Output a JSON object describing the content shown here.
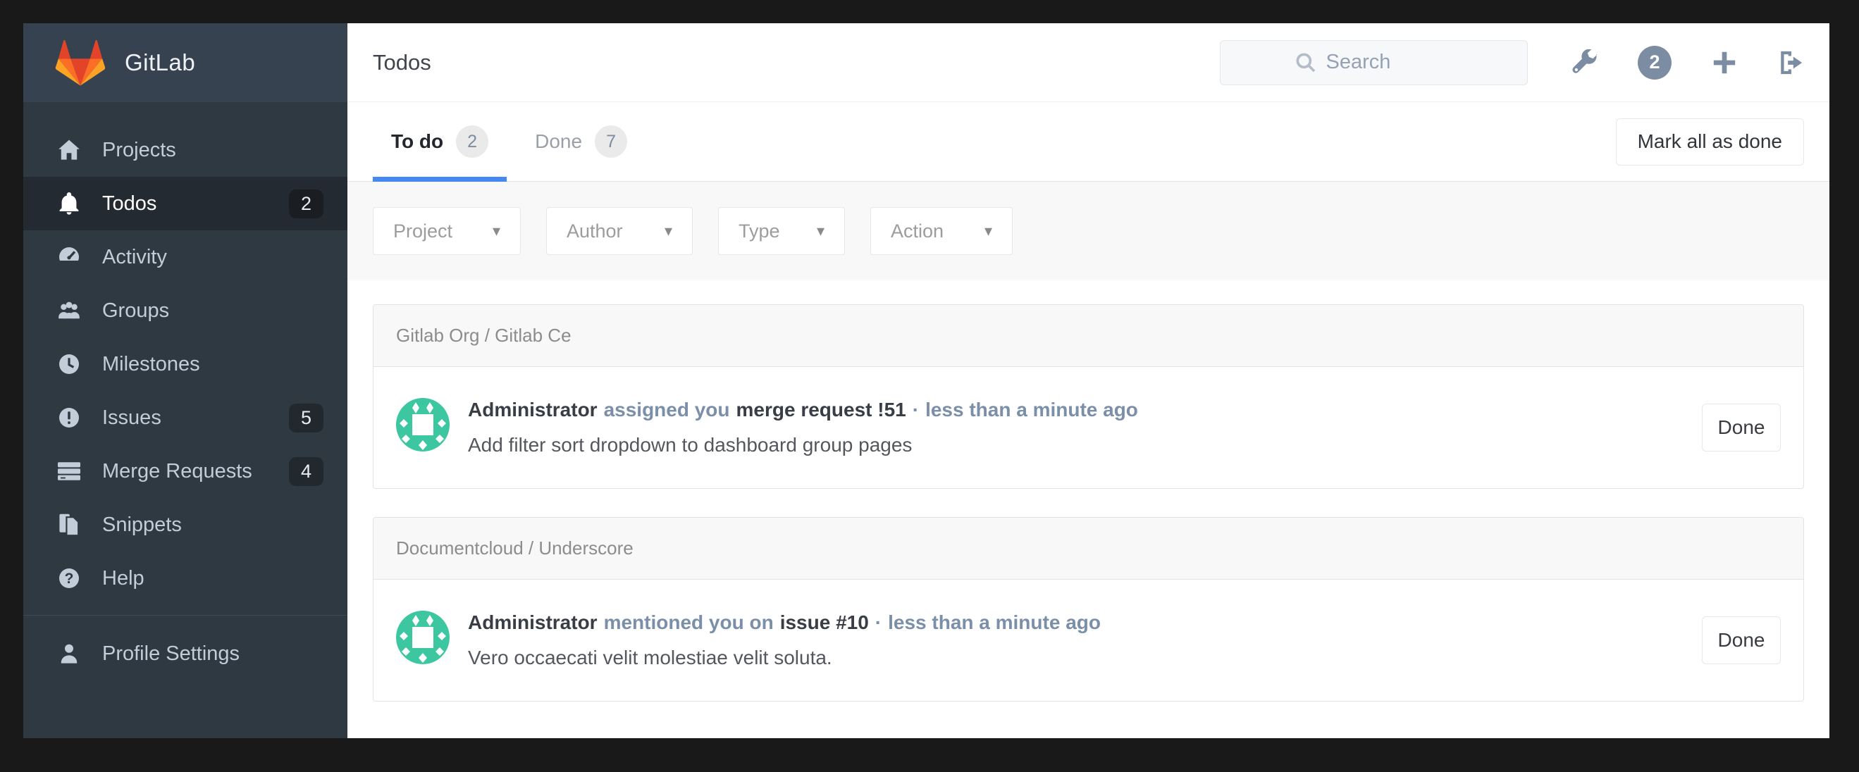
{
  "header": {
    "title": "Todos",
    "search_placeholder": "Search",
    "todo_count_bubble": "2"
  },
  "sidebar": {
    "logo_text": "GitLab",
    "items": [
      {
        "label": "Projects",
        "icon": "home-icon",
        "badge": ""
      },
      {
        "label": "Todos",
        "icon": "bell-icon",
        "badge": "2"
      },
      {
        "label": "Activity",
        "icon": "activity-gauge-icon",
        "badge": ""
      },
      {
        "label": "Groups",
        "icon": "groups-icon",
        "badge": ""
      },
      {
        "label": "Milestones",
        "icon": "clock-icon",
        "badge": ""
      },
      {
        "label": "Issues",
        "icon": "issue-icon",
        "badge": "5"
      },
      {
        "label": "Merge Requests",
        "icon": "merge-requests-icon",
        "badge": "4"
      },
      {
        "label": "Snippets",
        "icon": "snippets-icon",
        "badge": ""
      },
      {
        "label": "Help",
        "icon": "help-icon",
        "badge": ""
      }
    ],
    "footer_item": {
      "label": "Profile Settings",
      "icon": "user-icon"
    }
  },
  "tabs": [
    {
      "label": "To do",
      "count": "2"
    },
    {
      "label": "Done",
      "count": "7"
    }
  ],
  "toolbar": {
    "mark_all_label": "Mark all as done"
  },
  "filters": [
    {
      "label": "Project"
    },
    {
      "label": "Author"
    },
    {
      "label": "Type"
    },
    {
      "label": "Action"
    }
  ],
  "groups": [
    {
      "title": "Gitlab Org / Gitlab Ce",
      "item": {
        "author": "Administrator",
        "action": "assigned you",
        "target": "merge request !51",
        "separator": "·",
        "time": "less than a minute ago",
        "body": "Add filter sort dropdown to dashboard group pages",
        "done_label": "Done"
      }
    },
    {
      "title": "Documentcloud / Underscore",
      "item": {
        "author": "Administrator",
        "action": "mentioned you on",
        "target": "issue #10",
        "separator": "·",
        "time": "less than a minute ago",
        "body": "Vero occaecati velit molestiae velit soluta.",
        "done_label": "Done"
      }
    }
  ],
  "icons": {
    "help_glyph": "?"
  },
  "colors": {
    "frame": "#191919",
    "sidebar_bg": "#2f3942",
    "sidebar_header_bg": "#374250",
    "sidebar_active_bg": "#242a31",
    "tab_underline": "#4688f1",
    "slate_link": "#7b8fa9",
    "avatar_green": "#3dc7a0",
    "logo_red": "#e24329",
    "logo_orange": "#fc6d26",
    "logo_yellow": "#fca326"
  }
}
